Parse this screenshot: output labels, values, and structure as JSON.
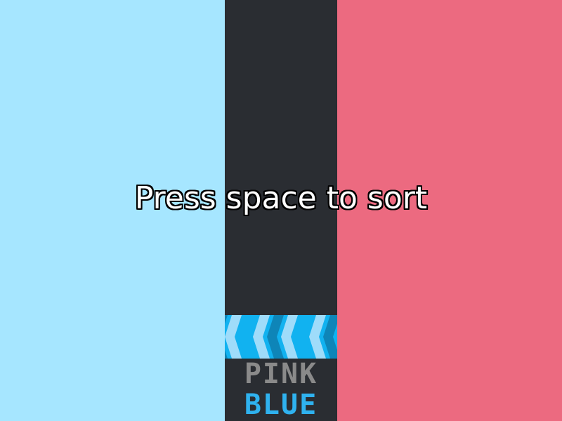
{
  "colors": {
    "blue_zone": "#a6e6ff",
    "center_lane": "#2a2d32",
    "pink_zone": "#ec6a80",
    "conveyor_dark": "#0e85b8",
    "conveyor_mid": "#11b2f0",
    "conveyor_light": "#9fdcfa",
    "word_inactive": "#8a8a8a",
    "word_active": "#2fb2ef"
  },
  "prompt": {
    "text": "Press space to sort"
  },
  "conveyor": {
    "direction": "left",
    "chevron_icon": "chevron-left-icon"
  },
  "queue": {
    "top_word": "PINK",
    "bottom_word": "BLUE"
  }
}
